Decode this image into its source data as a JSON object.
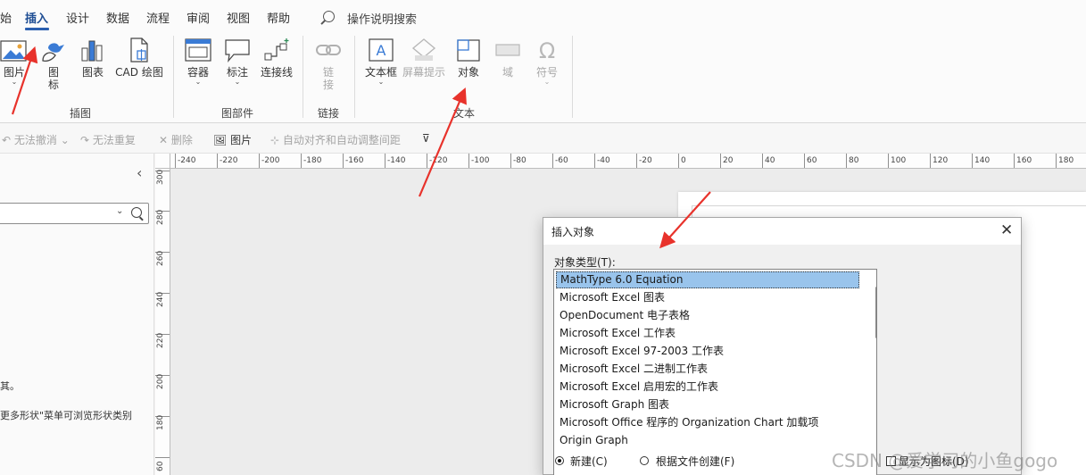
{
  "tabs": [
    {
      "label": "始",
      "active": false
    },
    {
      "label": "插入",
      "active": true
    },
    {
      "label": "设计",
      "active": false
    },
    {
      "label": "数据",
      "active": false
    },
    {
      "label": "流程",
      "active": false
    },
    {
      "label": "审阅",
      "active": false
    },
    {
      "label": "视图",
      "active": false
    },
    {
      "label": "帮助",
      "active": false
    }
  ],
  "search": {
    "label": "操作说明搜索"
  },
  "ribbon": {
    "illustrations": {
      "group_label": "插图",
      "picture": "图片",
      "icon_line1": "图",
      "icon_line2": "标",
      "chart": "图表",
      "cad": "CAD 绘图"
    },
    "diagram_parts": {
      "group_label": "图部件",
      "container": "容器",
      "callout": "标注",
      "connector": "连接线"
    },
    "links": {
      "group_label": "链接",
      "link_line1": "链",
      "link_line2": "接"
    },
    "text": {
      "group_label": "文本",
      "textbox": "文本框",
      "screentip": "屏幕提示",
      "object": "对象",
      "field": "域",
      "symbol": "符号"
    }
  },
  "quick_toolbar": {
    "undo": "无法撤消",
    "redo": "无法重复",
    "delete": "删除",
    "picture": "图片",
    "auto_align": "自动对齐和自动调整间距"
  },
  "left_pane": {
    "line1": "其。",
    "line2": "更多形状\"菜单可浏览形状类别"
  },
  "rulers": {
    "horizontal": [
      "-240",
      "-220",
      "-200",
      "-180",
      "-160",
      "-140",
      "-120",
      "-100",
      "-80",
      "-60",
      "-40",
      "-20",
      "0",
      "20",
      "40",
      "60",
      "80",
      "100",
      "120",
      "140",
      "160",
      "180"
    ],
    "vertical": [
      "300",
      "280",
      "260",
      "240",
      "220",
      "200",
      "180",
      "60"
    ]
  },
  "dialog": {
    "title": "插入对象",
    "type_label": "对象类型(T):",
    "object_types": [
      "MathType 6.0 Equation",
      "Microsoft Excel 图表",
      "OpenDocument 电子表格",
      "Microsoft Excel 工作表",
      "Microsoft Excel 97-2003 工作表",
      "Microsoft Excel 二进制工作表",
      "Microsoft Excel 启用宏的工作表",
      "Microsoft Graph 图表",
      "Microsoft Office 程序的 Organization Chart 加载项",
      "Origin Graph"
    ],
    "selected_index": 0,
    "radio_new": "新建(C)",
    "radio_from_file": "根据文件创建(F)",
    "display_as_icon": "显示为图标(D)"
  },
  "watermark": "CSDN @爱学习的小鱼gogo",
  "colors": {
    "accent": "#2b5fb0",
    "arrow": "#e8322b",
    "selection": "#99c4ec"
  }
}
